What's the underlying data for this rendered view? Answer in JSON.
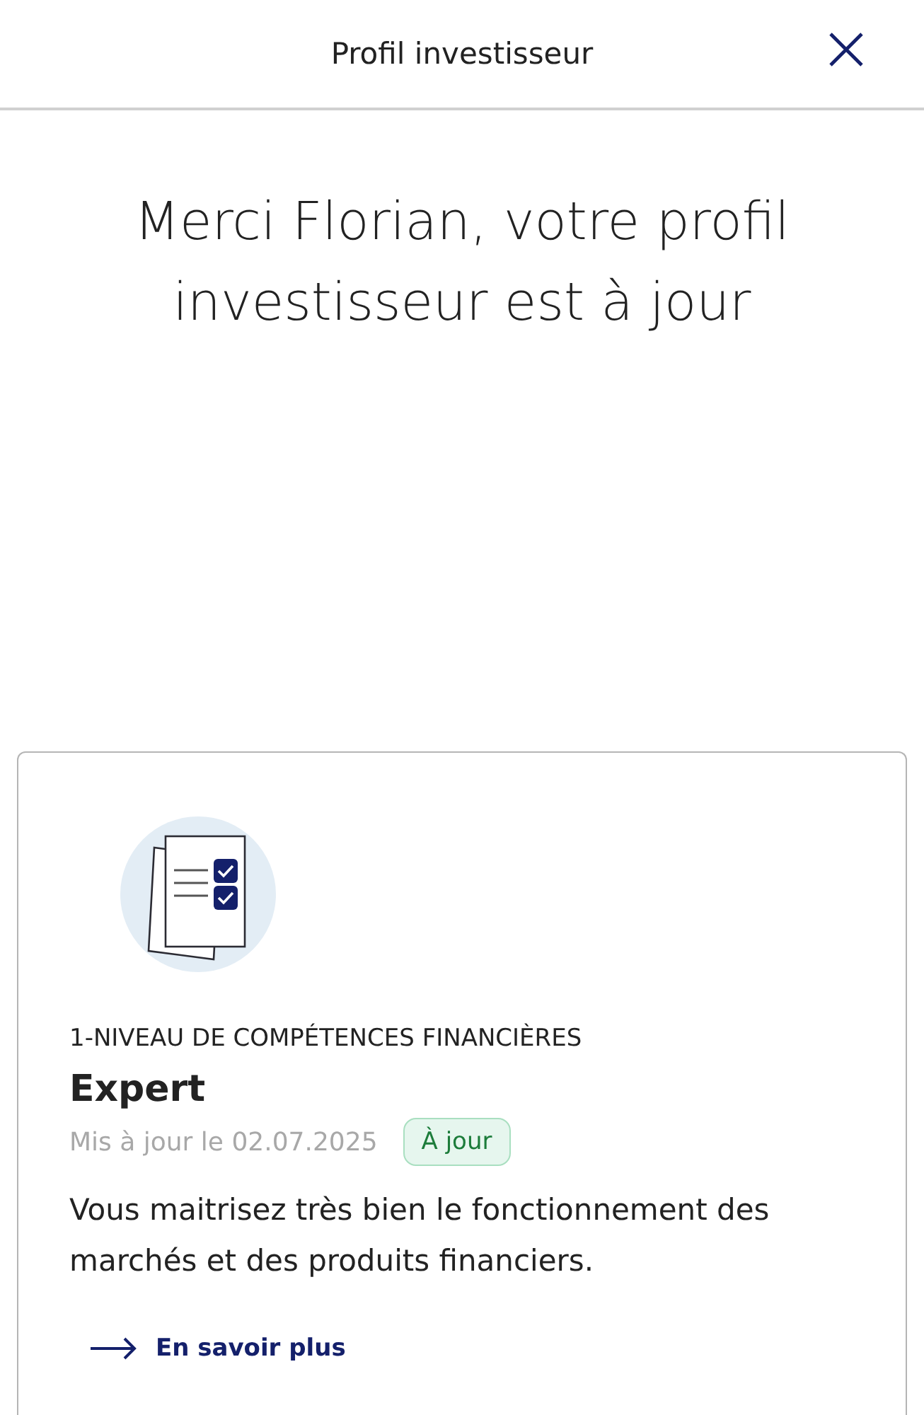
{
  "header": {
    "title": "Profil investisseur"
  },
  "headline": "Merci Florian, votre profil investisseur est à jour",
  "cards": [
    {
      "category": "1-NIVEAU DE COMPÉTENCES FINANCIÈRES",
      "result": "Expert",
      "updated": "Mis à jour le 02.07.2025",
      "status": {
        "label": "À jour",
        "kind": "ok"
      },
      "description": "Vous maitrisez très bien le fonctionnement des marchés et des produits financiers.",
      "link": "En savoir plus"
    }
  ]
}
